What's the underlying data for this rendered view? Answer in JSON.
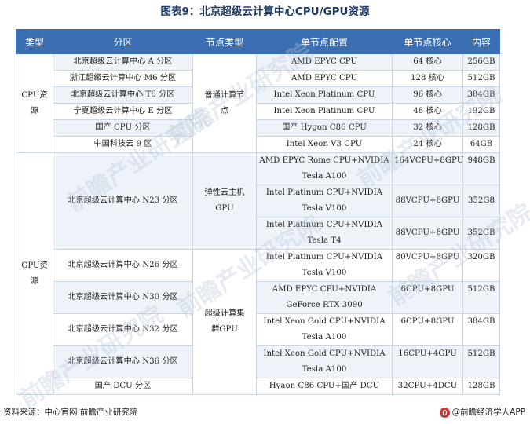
{
  "title": "图表9：北京超级云计算中心CPU/GPU资源",
  "headers": [
    "类型",
    "分区",
    "节点类型",
    "单节点配置",
    "单节点核心",
    "内容"
  ],
  "groups": {
    "cpu": "CPU资源",
    "gpu": "GPU资源",
    "node_general": "普通计算节点",
    "node_elastic": "弹性云主机GPU",
    "node_super": "超级计算集群GPU"
  },
  "rows": [
    {
      "partition": "北京超级云计算中心 A 分区",
      "config": "AMD EPYC CPU",
      "cores": "64 核心",
      "memory": "256GB"
    },
    {
      "partition": "浙江超级云计算中心 M6 分区",
      "config": "AMD EPYC CPU",
      "cores": "128 核心",
      "memory": "512GB"
    },
    {
      "partition": "北京超级云计算中心 T6 分区",
      "config": "Intel Xeon Platinum CPU",
      "cores": "96 核心",
      "memory": "384GB"
    },
    {
      "partition": "宁夏超级云计算中心 E 分区",
      "config": "Intel Xeon Platinum CPU",
      "cores": "48 核心",
      "memory": "192GB"
    },
    {
      "partition": "国产 CPU 分区",
      "config": "国产 Hygon C86 CPU",
      "cores": "32 核心",
      "memory": "128GB"
    },
    {
      "partition": "中国科技云 9 区",
      "config": "Intel Xeon V3 CPU",
      "cores": "24 核心",
      "memory": "64GB"
    },
    {
      "partition": "北京超级云计算中心 N23 分区",
      "config": "AMD EPYC Rome CPU+NVIDIA Tesla A100",
      "cores": "164VCPU+8GPU",
      "memory": "948GB"
    },
    {
      "partition": "",
      "config": "Intel Platinum CPU+NVIDIA Tesla V100",
      "cores": "88VCPU+8GPU",
      "memory": "352G8"
    },
    {
      "partition": "",
      "config": "Intel Platinum CPU+NVIDIA Tesla T4",
      "cores": "88VCPU+8GPU",
      "memory": "352GB"
    },
    {
      "partition": "北京超级云计算中心 N26 分区",
      "config": "Intel Platinum CPU+NVIDIA Tesla V100",
      "cores": "80VCPU+8GPU",
      "memory": "320GB"
    },
    {
      "partition": "北京超级云计算中心 N30 分区",
      "config": "AMD EPYC CPU+NVIDIA GeForce RTX 3090",
      "cores": "6CPU+8GPU",
      "memory": "512GB"
    },
    {
      "partition": "北京超级云计算中心 N32 分区",
      "config": "Intel Xeon Gold CPU+NVIDIA Tesla A100",
      "cores": "6CPU+8GPU",
      "memory": "384GB"
    },
    {
      "partition": "北京超级云计算中心 N36 分区",
      "config": "Intel Xeon Gold CPU+NVIDIA Tesla A100",
      "cores": "16CPU+4GPU",
      "memory": "512GB"
    },
    {
      "partition": "国产 DCU 分区",
      "config": "Hyaon C86 CPU+国产 DCU",
      "cores": "32CPU+4DCU",
      "memory": "128GB"
    }
  ],
  "watermark_text": "前瞻产业研究院",
  "footer": {
    "source": "资料来源：中心官网 前瞻产业研究院",
    "brand": "@前瞻经济学人APP"
  }
}
